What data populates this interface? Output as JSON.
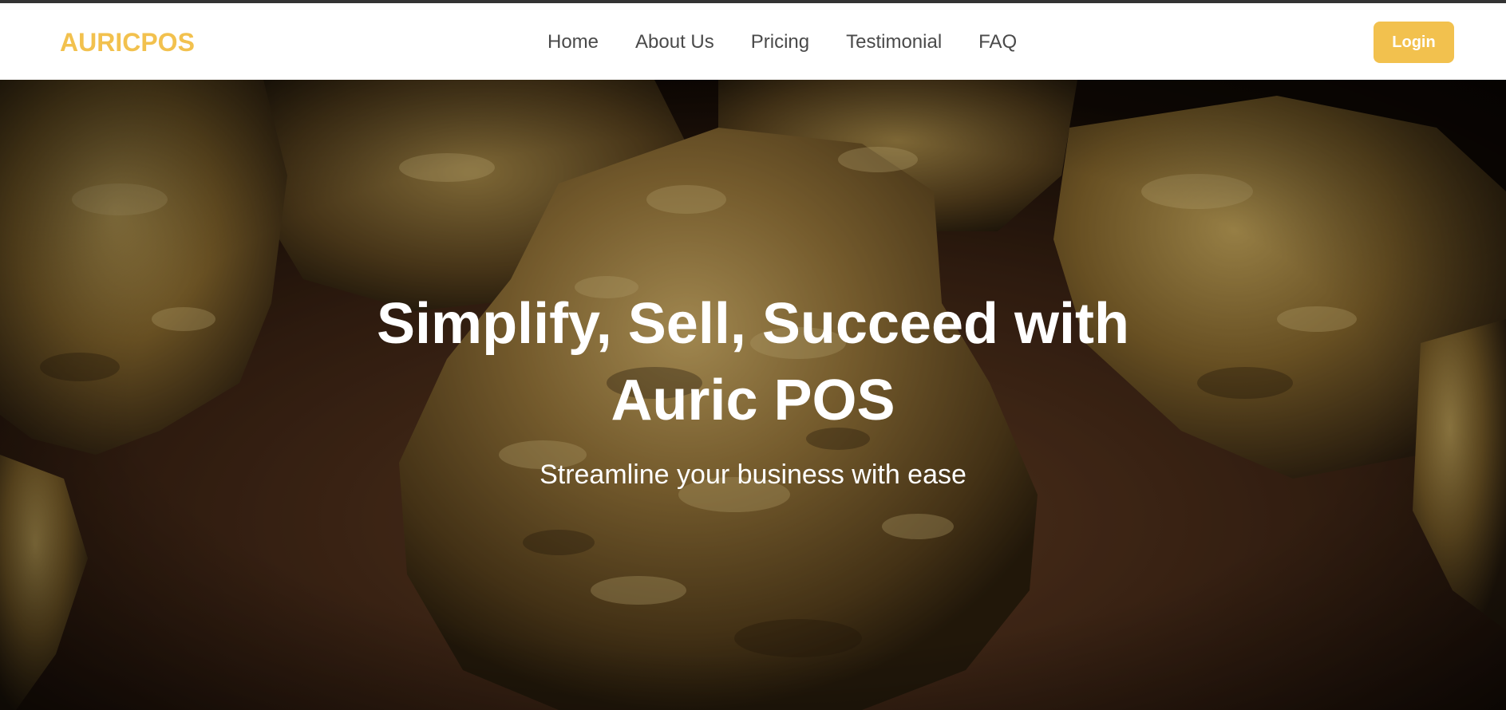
{
  "brand": {
    "logo_text": "AURICPOS",
    "accent_color": "#f2c14e"
  },
  "nav": {
    "items": [
      {
        "label": "Home"
      },
      {
        "label": "About Us"
      },
      {
        "label": "Pricing"
      },
      {
        "label": "Testimonial"
      },
      {
        "label": "FAQ"
      }
    ],
    "login_label": "Login"
  },
  "hero": {
    "title_line1": "Simplify, Sell, Succeed with",
    "title_line2": "Auric POS",
    "subtitle": "Streamline your business with ease",
    "image": "gold-nuggets-photo"
  }
}
